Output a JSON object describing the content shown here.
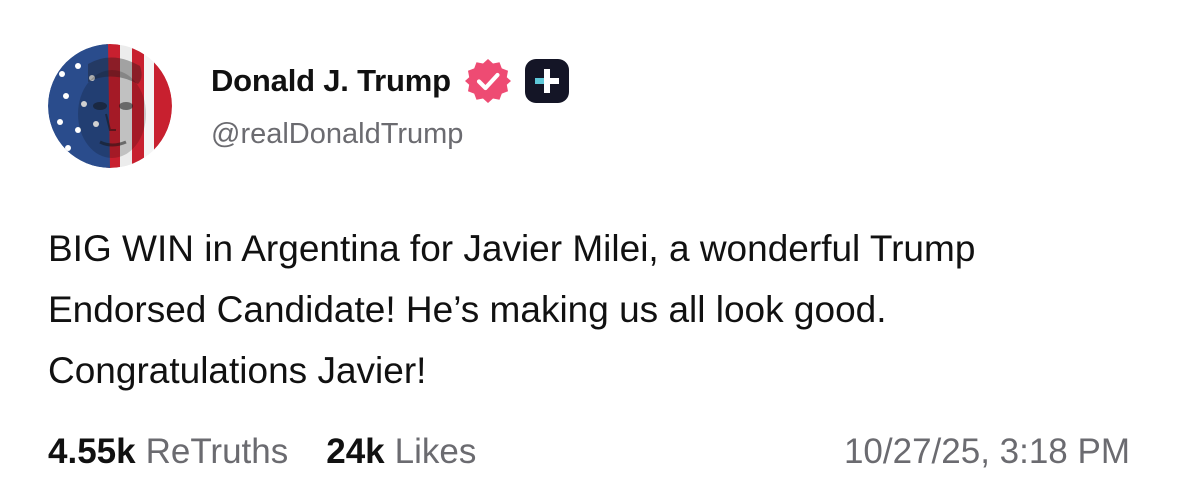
{
  "author": {
    "display_name": "Donald J. Trump",
    "handle": "@realDonaldTrump",
    "avatar_icon": "flag-portrait-avatar",
    "verified_icon": "verified-check-icon",
    "plus_icon": "plus-badge-icon"
  },
  "post": {
    "lines": [
      "BIG WIN in Argentina for Javier Milei, a wonderful Trump",
      "Endorsed Candidate! He’s making us all look good.",
      "Congratulations Javier!"
    ]
  },
  "stats": {
    "retruths_count": "4.55k",
    "retruths_label": "ReTruths",
    "likes_count": "24k",
    "likes_label": "Likes"
  },
  "timestamp": "10/27/25, 3:18 PM",
  "colors": {
    "verified_badge": "#ee4b73",
    "plus_badge": "#141526",
    "secondary_text": "#6b6b70",
    "flag_red": "#c8202f",
    "flag_blue": "#2a4c8c"
  }
}
